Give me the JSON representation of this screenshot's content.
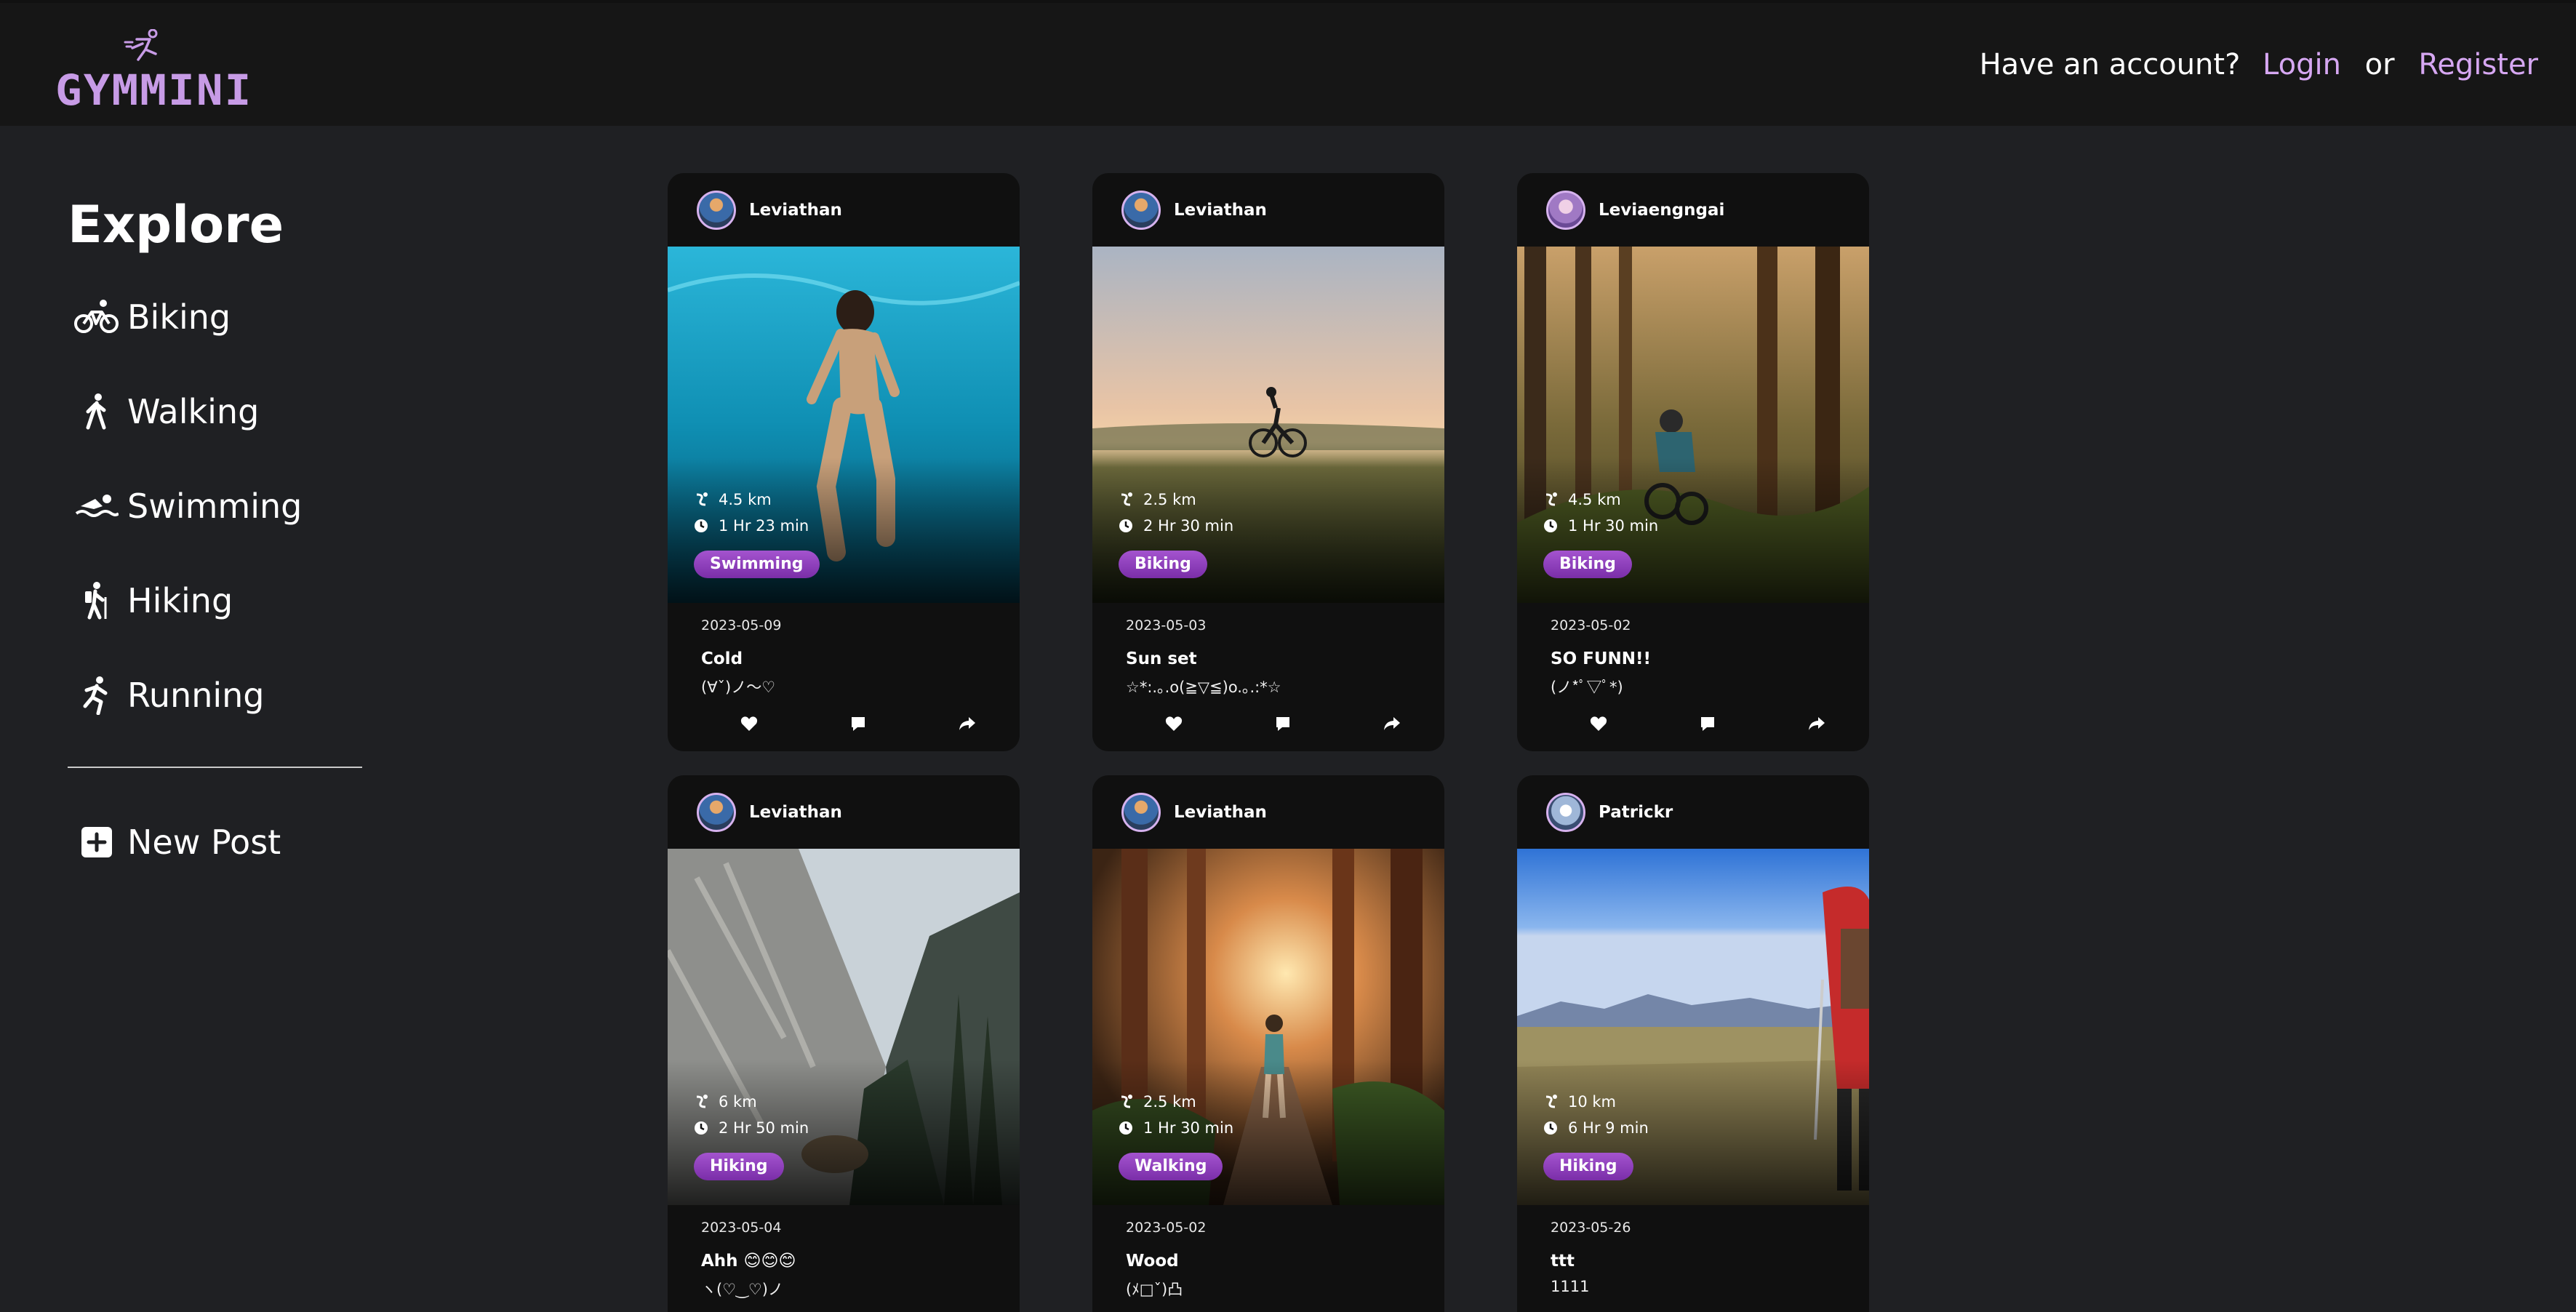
{
  "header": {
    "logo_text": "GYMMINI",
    "auth_prompt": "Have an account?",
    "login": "Login",
    "or": "or",
    "register": "Register"
  },
  "sidebar": {
    "title": "Explore",
    "items": [
      {
        "label": "Biking",
        "icon": "bike-icon"
      },
      {
        "label": "Walking",
        "icon": "walking-icon"
      },
      {
        "label": "Swimming",
        "icon": "swimming-icon"
      },
      {
        "label": "Hiking",
        "icon": "hiking-icon"
      },
      {
        "label": "Running",
        "icon": "running-icon"
      }
    ],
    "new_post": "New Post"
  },
  "posts": [
    {
      "user": "Leviathan",
      "distance": "4.5 km",
      "duration": "1 Hr 23 min",
      "tag": "Swimming",
      "date": "2023-05-09",
      "title": "Cold",
      "desc": "(∀ˇ)ノ～♡"
    },
    {
      "user": "Leviathan",
      "distance": "2.5 km",
      "duration": "2 Hr 30 min",
      "tag": "Biking",
      "date": "2023-05-03",
      "title": "Sun set",
      "desc": "☆*:.｡.o(≧▽≦)o.｡.:*☆"
    },
    {
      "user": "Leviaengngai",
      "distance": "4.5 km",
      "duration": "1 Hr 30 min",
      "tag": "Biking",
      "date": "2023-05-02",
      "title": "SO FUNN!!",
      "desc": "(ノ*ﾟ▽ﾟ*)"
    },
    {
      "user": "Leviathan",
      "distance": "6 km",
      "duration": "2 Hr 50 min",
      "tag": "Hiking",
      "date": "2023-05-04",
      "title": "Ahh 😊😊😊",
      "desc": "ヽ(♡‿♡)ノ"
    },
    {
      "user": "Leviathan",
      "distance": "2.5 km",
      "duration": "1 Hr 30 min",
      "tag": "Walking",
      "date": "2023-05-02",
      "title": "Wood",
      "desc": "(ﾒ□ˇ)凸"
    },
    {
      "user": "Patrickr",
      "distance": "10 km",
      "duration": "6 Hr 9 min",
      "tag": "Hiking",
      "date": "2023-05-26",
      "title": "ttt",
      "desc": "1111"
    }
  ],
  "colors": {
    "accent": "#c79be6",
    "tag": "#8e3fbd",
    "card": "#101010",
    "page": "#1f2023",
    "header": "#161616"
  }
}
